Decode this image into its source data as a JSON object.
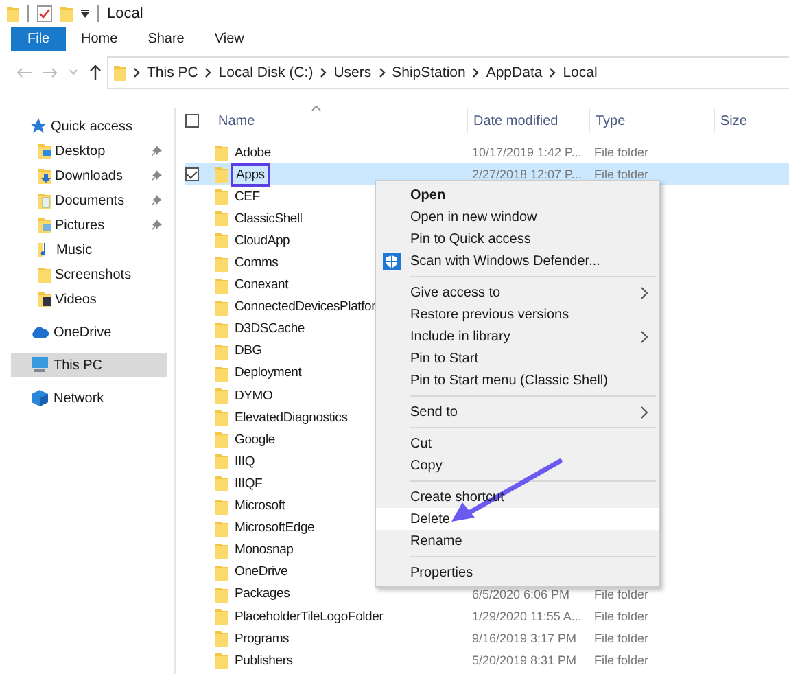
{
  "window": {
    "title": "Local"
  },
  "ribbon_tabs": [
    {
      "label": "File",
      "selected": true
    },
    {
      "label": "Home",
      "selected": false
    },
    {
      "label": "Share",
      "selected": false
    },
    {
      "label": "View",
      "selected": false
    }
  ],
  "address_bar": {
    "crumbs": [
      "This PC",
      "Local Disk (C:)",
      "Users",
      "ShipStation",
      "AppData",
      "Local"
    ]
  },
  "sidebar": [
    {
      "label": "Quick access",
      "selected": false,
      "children": [
        {
          "label": "Desktop",
          "pinned": true,
          "selected": false
        },
        {
          "label": "Downloads",
          "pinned": true,
          "selected": false
        },
        {
          "label": "Documents",
          "pinned": true,
          "selected": false
        },
        {
          "label": "Pictures",
          "pinned": true,
          "selected": false
        },
        {
          "label": "Music",
          "pinned": false,
          "selected": false
        },
        {
          "label": "Screenshots",
          "pinned": false,
          "selected": false
        },
        {
          "label": "Videos",
          "pinned": false,
          "selected": false
        }
      ]
    },
    {
      "label": "OneDrive",
      "selected": false
    },
    {
      "label": "This PC",
      "selected": true
    },
    {
      "label": "Network",
      "selected": false
    }
  ],
  "table": {
    "columns": [
      "Name",
      "Date modified",
      "Type",
      "Size"
    ],
    "all_checked": false,
    "rows": [
      {
        "name": "Adobe",
        "date": "10/17/2019 1:42 P...",
        "type": "File folder",
        "selected": false,
        "checked": false,
        "outlined": false
      },
      {
        "name": "Apps",
        "date": "2/27/2018 12:07 P...",
        "type": "File folder",
        "selected": true,
        "checked": true,
        "outlined": true
      },
      {
        "name": "CEF",
        "selected": false,
        "checked": false,
        "outlined": false
      },
      {
        "name": "ClassicShell",
        "selected": false,
        "checked": false,
        "outlined": false
      },
      {
        "name": "CloudApp",
        "selected": false,
        "checked": false,
        "outlined": false
      },
      {
        "name": "Comms",
        "selected": false,
        "checked": false,
        "outlined": false
      },
      {
        "name": "Conexant",
        "selected": false,
        "checked": false,
        "outlined": false
      },
      {
        "name": "ConnectedDevicesPlatfor",
        "selected": false,
        "checked": false,
        "outlined": false
      },
      {
        "name": "D3DSCache",
        "selected": false,
        "checked": false,
        "outlined": false
      },
      {
        "name": "DBG",
        "selected": false,
        "checked": false,
        "outlined": false
      },
      {
        "name": "Deployment",
        "selected": false,
        "checked": false,
        "outlined": false
      },
      {
        "name": "DYMO",
        "selected": false,
        "checked": false,
        "outlined": false
      },
      {
        "name": "ElevatedDiagnostics",
        "selected": false,
        "checked": false,
        "outlined": false
      },
      {
        "name": "Google",
        "selected": false,
        "checked": false,
        "outlined": false
      },
      {
        "name": "IIIQ",
        "selected": false,
        "checked": false,
        "outlined": false
      },
      {
        "name": "IIIQF",
        "selected": false,
        "checked": false,
        "outlined": false
      },
      {
        "name": "Microsoft",
        "selected": false,
        "checked": false,
        "outlined": false
      },
      {
        "name": "MicrosoftEdge",
        "selected": false,
        "checked": false,
        "outlined": false
      },
      {
        "name": "Monosnap",
        "selected": false,
        "checked": false,
        "outlined": false
      },
      {
        "name": "OneDrive",
        "selected": false,
        "checked": false,
        "outlined": false
      },
      {
        "name": "Packages",
        "date": "6/5/2020 6:06 PM",
        "type": "File folder",
        "selected": false,
        "checked": false,
        "outlined": false
      },
      {
        "name": "PlaceholderTileLogoFolder",
        "date": "1/29/2020 11:55 A...",
        "type": "File folder",
        "selected": false,
        "checked": false,
        "outlined": false
      },
      {
        "name": "Programs",
        "date": "9/16/2019 3:17 PM",
        "type": "File folder",
        "selected": false,
        "checked": false,
        "outlined": false
      },
      {
        "name": "Publishers",
        "date": "5/20/2019 8:31 PM",
        "type": "File folder",
        "selected": false,
        "checked": false,
        "outlined": false
      }
    ]
  },
  "context_menu": {
    "groups": [
      [
        {
          "label": "Open",
          "kind": "plain",
          "default": true,
          "submenu": false,
          "highlighted": false
        },
        {
          "label": "Open in new window",
          "kind": "plain",
          "default": false,
          "submenu": false,
          "highlighted": false
        },
        {
          "label": "Pin to Quick access",
          "kind": "plain",
          "default": false,
          "submenu": false,
          "highlighted": false
        },
        {
          "label": "Scan with Windows Defender...",
          "kind": "shield",
          "default": false,
          "submenu": false,
          "highlighted": false
        }
      ],
      [
        {
          "label": "Give access to",
          "kind": "plain",
          "default": false,
          "submenu": true,
          "highlighted": false
        },
        {
          "label": "Restore previous versions",
          "kind": "plain",
          "default": false,
          "submenu": false,
          "highlighted": false
        },
        {
          "label": "Include in library",
          "kind": "plain",
          "default": false,
          "submenu": true,
          "highlighted": false
        },
        {
          "label": "Pin to Start",
          "kind": "plain",
          "default": false,
          "submenu": false,
          "highlighted": false
        },
        {
          "label": "Pin to Start menu (Classic Shell)",
          "kind": "plain",
          "default": false,
          "submenu": false,
          "highlighted": false
        }
      ],
      [
        {
          "label": "Send to",
          "kind": "plain",
          "default": false,
          "submenu": true,
          "highlighted": false
        }
      ],
      [
        {
          "label": "Cut",
          "kind": "plain",
          "default": false,
          "submenu": false,
          "highlighted": false
        },
        {
          "label": "Copy",
          "kind": "plain",
          "default": false,
          "submenu": false,
          "highlighted": false
        }
      ],
      [
        {
          "label": "Create shortcut",
          "kind": "plain",
          "default": false,
          "submenu": false,
          "highlighted": false
        },
        {
          "label": "Delete",
          "kind": "plain",
          "default": false,
          "submenu": false,
          "highlighted": true
        },
        {
          "label": "Rename",
          "kind": "plain",
          "default": false,
          "submenu": false,
          "highlighted": false
        }
      ],
      [
        {
          "label": "Properties",
          "kind": "plain",
          "default": false,
          "submenu": false,
          "highlighted": false
        }
      ]
    ]
  },
  "pointer_arrow": true
}
